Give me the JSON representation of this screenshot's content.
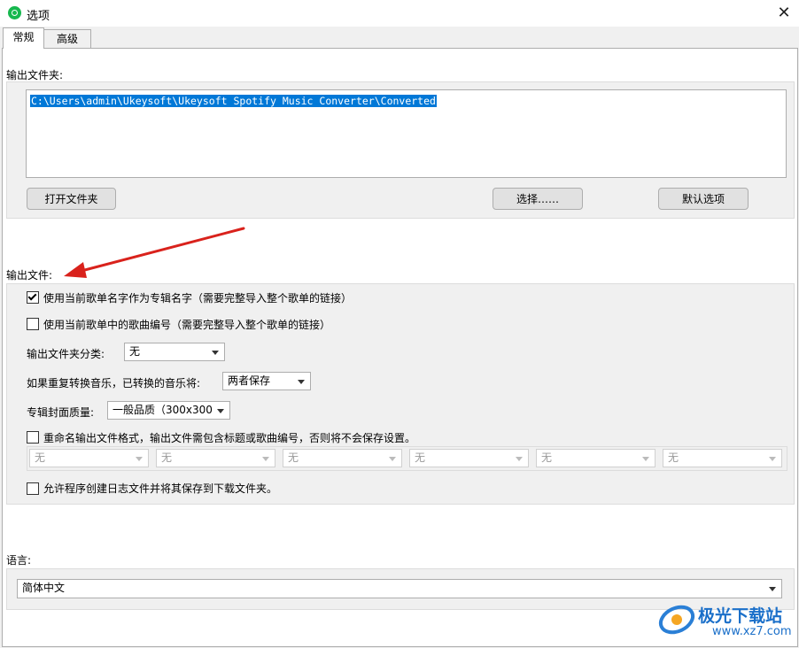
{
  "window": {
    "title": "选项",
    "close_glyph": "✕"
  },
  "tabs": [
    {
      "label": "常规",
      "active": true
    },
    {
      "label": "高级",
      "active": false
    }
  ],
  "output_folder": {
    "label": "输出文件夹:",
    "path": "C:\\Users\\admin\\Ukeysoft\\Ukeysoft Spotify Music Converter\\Converted",
    "open_button": "打开文件夹",
    "choose_button": "选择……",
    "default_button": "默认选项"
  },
  "output_file": {
    "label": "输出文件:",
    "use_playlist_name": {
      "label": "使用当前歌单名字作为专辑名字（需要完整导入整个歌单的链接）",
      "checked": true
    },
    "use_track_number": {
      "label": "使用当前歌单中的歌曲编号（需要完整导入整个歌单的链接）",
      "checked": false
    },
    "folder_category": {
      "label": "输出文件夹分类:",
      "value": "无"
    },
    "repeat_convert": {
      "label": "如果重复转换音乐，已转换的音乐将:",
      "value": "两者保存"
    },
    "cover_quality": {
      "label": "专辑封面质量:",
      "value": "一般品质（300x300"
    },
    "rename_format": {
      "label": "重命名输出文件格式，输出文件需包含标题或歌曲编号，否则将不会保存设置。",
      "checked": false,
      "fields": [
        "无",
        "无",
        "无",
        "无",
        "无",
        "无"
      ]
    },
    "allow_log": {
      "label": "允许程序创建日志文件并将其保存到下载文件夹。",
      "checked": false
    }
  },
  "language": {
    "label": "语言:",
    "value": "简体中文"
  },
  "watermark": {
    "text": "极光下载站",
    "url": "www.xz7.com"
  },
  "colors": {
    "selection": "#0078d7",
    "arrow": "#d9221c",
    "icon": "#16b84e"
  }
}
